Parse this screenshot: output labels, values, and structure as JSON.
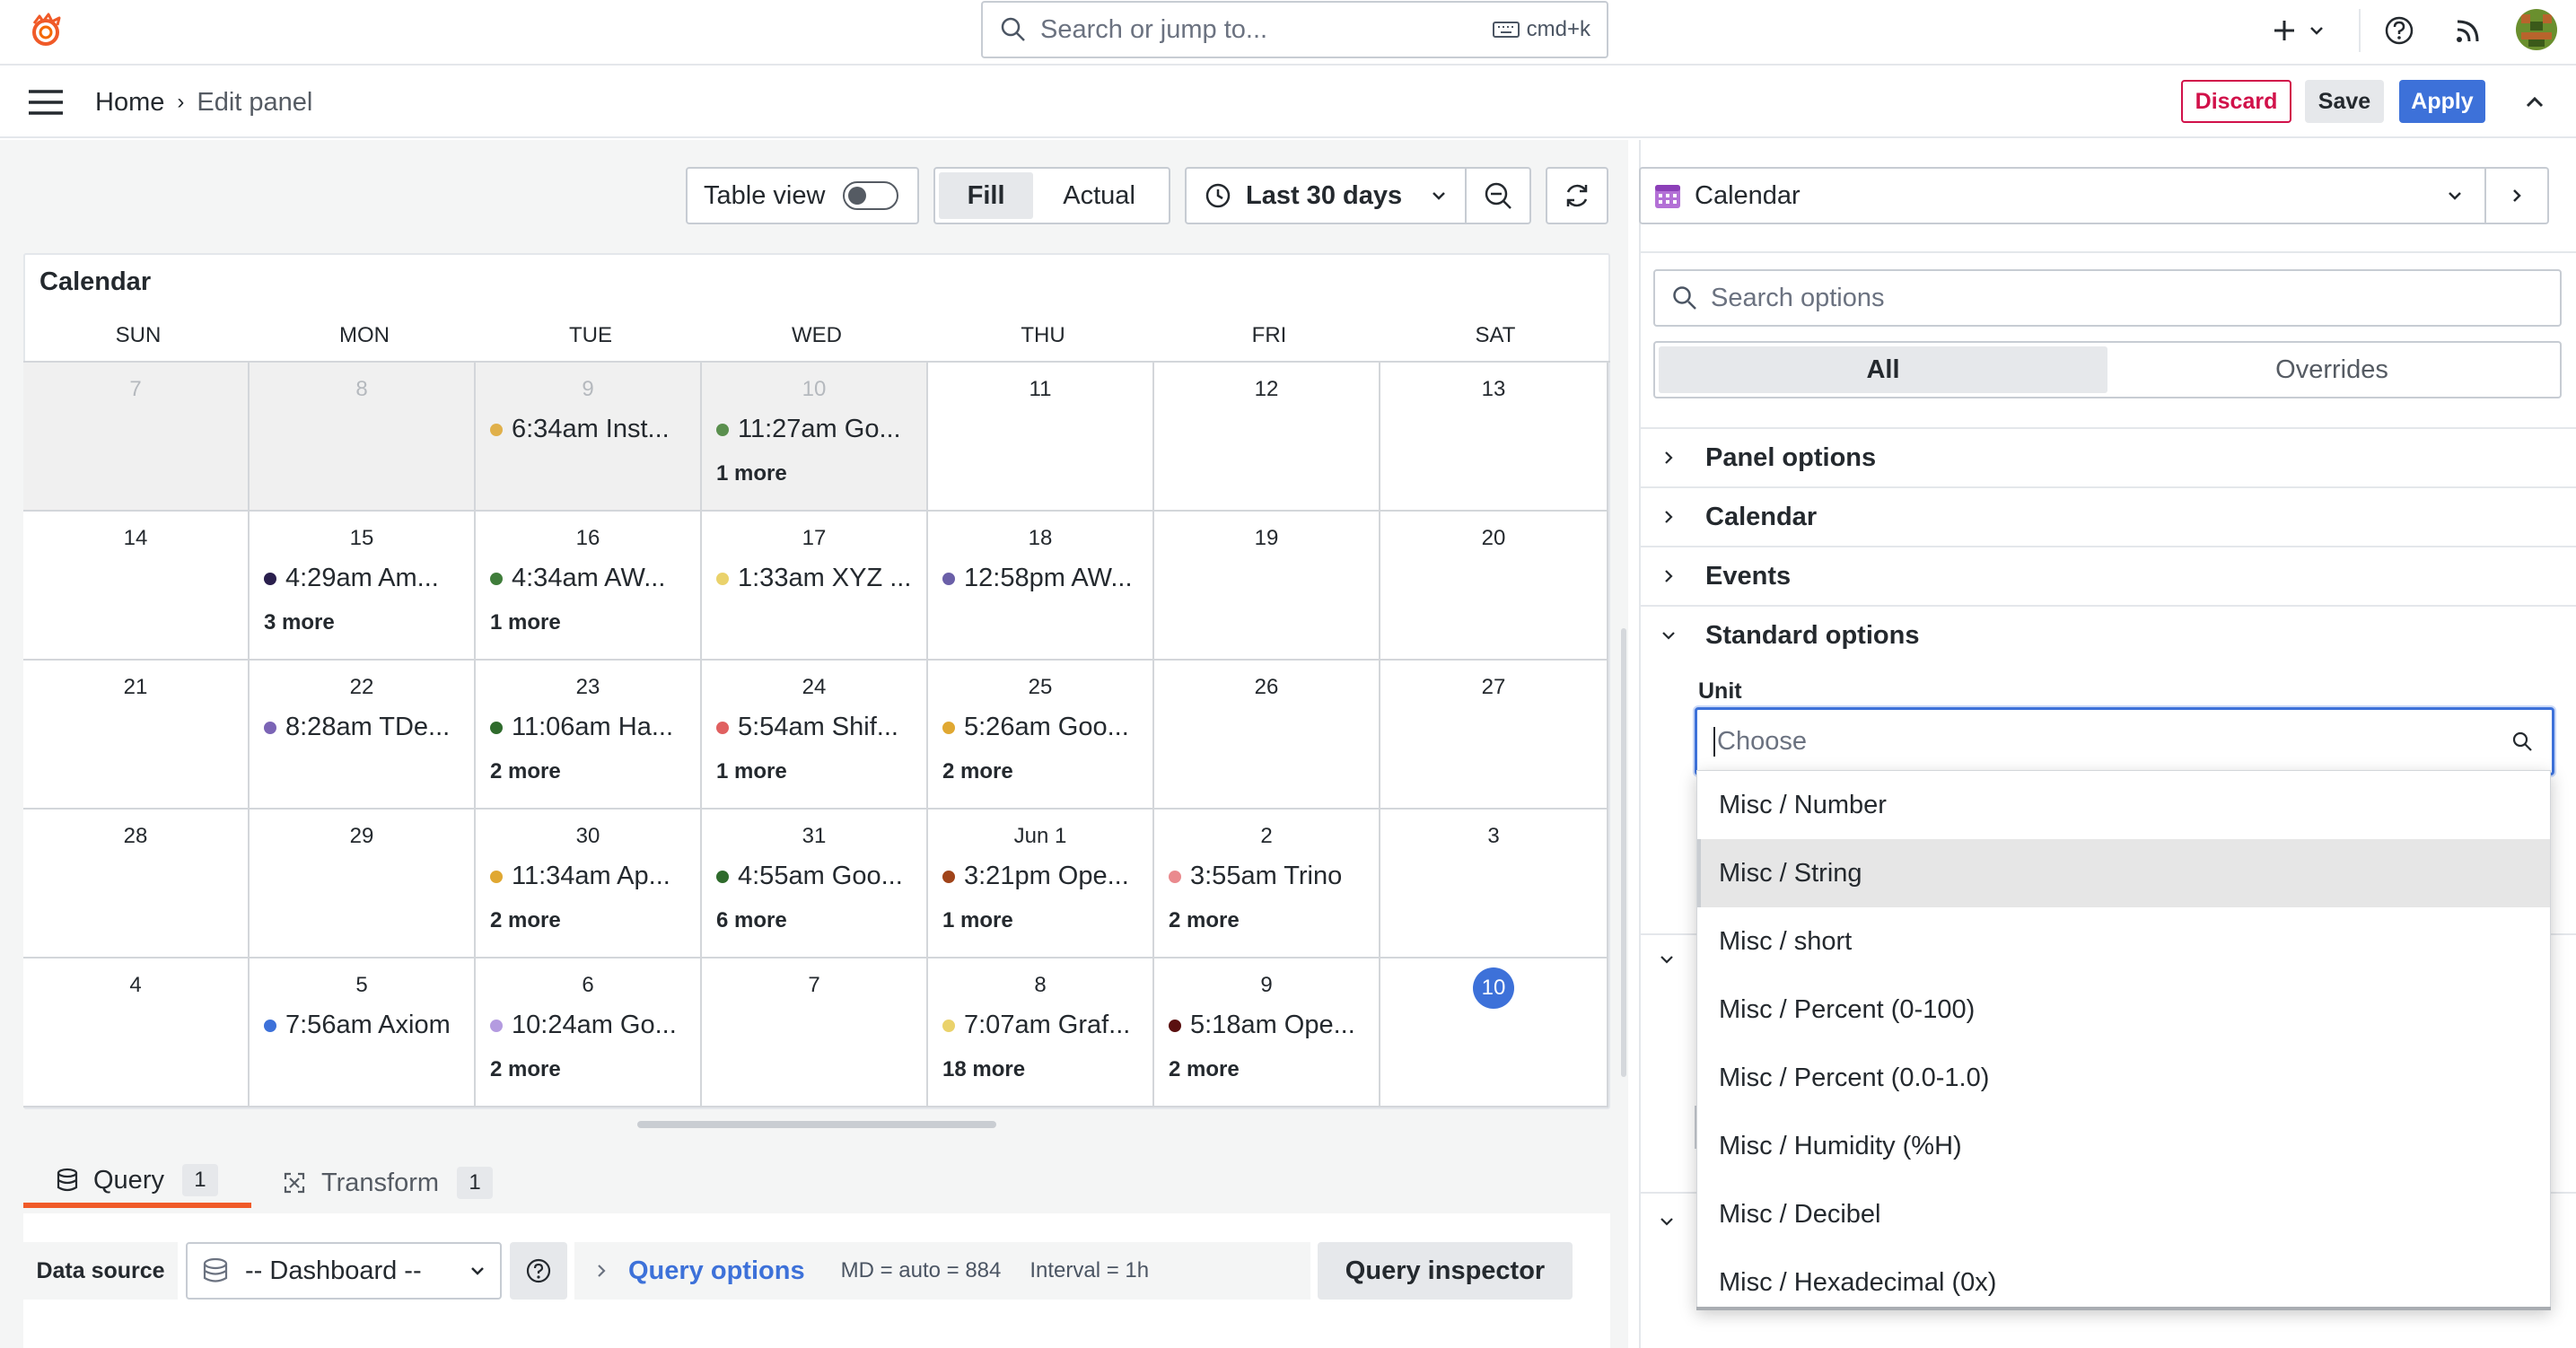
{
  "topbar": {
    "search_placeholder": "Search or jump to...",
    "search_shortcut": "cmd+k"
  },
  "navbar": {
    "home": "Home",
    "current": "Edit panel",
    "discard": "Discard",
    "save": "Save",
    "apply": "Apply"
  },
  "toolbar": {
    "table_view": "Table view",
    "fill": "Fill",
    "actual": "Actual",
    "time_range": "Last 30 days"
  },
  "calendar": {
    "title": "Calendar",
    "weekdays": [
      "SUN",
      "MON",
      "TUE",
      "WED",
      "THU",
      "FRI",
      "SAT"
    ],
    "weeks": [
      [
        {
          "day": "7",
          "muted": true
        },
        {
          "day": "8",
          "muted": true
        },
        {
          "day": "9",
          "muted": true,
          "event": "6:34am Inst...",
          "color": "#e0b04a"
        },
        {
          "day": "10",
          "muted": true,
          "event": "11:27am Go...",
          "color": "#5a8f4e",
          "more": "1 more"
        },
        {
          "day": "11"
        },
        {
          "day": "12"
        },
        {
          "day": "13"
        }
      ],
      [
        {
          "day": "14"
        },
        {
          "day": "15",
          "event": "4:29am Am...",
          "color": "#2a1f4d",
          "more": "3 more"
        },
        {
          "day": "16",
          "event": "4:34am AW...",
          "color": "#3f7d3a",
          "more": "1 more"
        },
        {
          "day": "17",
          "event": "1:33am XYZ ...",
          "color": "#ead26b"
        },
        {
          "day": "18",
          "event": "12:58pm AW...",
          "color": "#6a5fa8"
        },
        {
          "day": "19"
        },
        {
          "day": "20"
        }
      ],
      [
        {
          "day": "21"
        },
        {
          "day": "22",
          "event": "8:28am TDe...",
          "color": "#7b64b5"
        },
        {
          "day": "23",
          "event": "11:06am Ha...",
          "color": "#2f6b2c",
          "more": "2 more"
        },
        {
          "day": "24",
          "event": "5:54am Shif...",
          "color": "#e06060",
          "more": "1 more"
        },
        {
          "day": "25",
          "event": "5:26am Goo...",
          "color": "#e0a832",
          "more": "2 more"
        },
        {
          "day": "26"
        },
        {
          "day": "27"
        }
      ],
      [
        {
          "day": "28"
        },
        {
          "day": "29"
        },
        {
          "day": "30",
          "event": "11:34am Ap...",
          "color": "#e0a832",
          "more": "2 more"
        },
        {
          "day": "31",
          "event": "4:55am Goo...",
          "color": "#2f6b2c",
          "more": "6 more"
        },
        {
          "day": "Jun 1",
          "event": "3:21pm Ope...",
          "color": "#a0441a",
          "more": "1 more"
        },
        {
          "day": "2",
          "event": "3:55am Trino",
          "color": "#ea8a8e",
          "more": "2 more"
        },
        {
          "day": "3"
        }
      ],
      [
        {
          "day": "4"
        },
        {
          "day": "5",
          "event": "7:56am Axiom",
          "color": "#3d71d9"
        },
        {
          "day": "6",
          "event": "10:24am Go...",
          "color": "#b49be0",
          "more": "2 more"
        },
        {
          "day": "7"
        },
        {
          "day": "8",
          "event": "7:07am Graf...",
          "color": "#ead26b",
          "more": "18 more"
        },
        {
          "day": "9",
          "event": "5:18am Ope...",
          "color": "#5a1010",
          "more": "2 more"
        },
        {
          "day": "10",
          "today": true
        }
      ]
    ]
  },
  "query": {
    "tab_query": "Query",
    "tab_query_count": "1",
    "tab_transform": "Transform",
    "tab_transform_count": "1",
    "data_source_label": "Data source",
    "data_source_value": "-- Dashboard --",
    "options_title": "Query options",
    "md": "MD = auto = 884",
    "interval": "Interval = 1h",
    "inspector": "Query inspector"
  },
  "options": {
    "viz_name": "Calendar",
    "search_placeholder": "Search options",
    "tab_all": "All",
    "tab_overrides": "Overrides",
    "sections": [
      "Panel options",
      "Calendar",
      "Events",
      "Standard options"
    ],
    "unit_label": "Unit",
    "unit_placeholder": "Choose",
    "unit_options": [
      "Misc / Number",
      "Misc / String",
      "Misc / short",
      "Misc / Percent (0-100)",
      "Misc / Percent (0.0-1.0)",
      "Misc / Humidity (%H)",
      "Misc / Decibel",
      "Misc / Hexadecimal (0x)"
    ],
    "highlighted_index": 1
  },
  "colors": {
    "accent": "#3d71d9",
    "discard": "#d1114a",
    "query_tab_underline": "#f05a28"
  }
}
